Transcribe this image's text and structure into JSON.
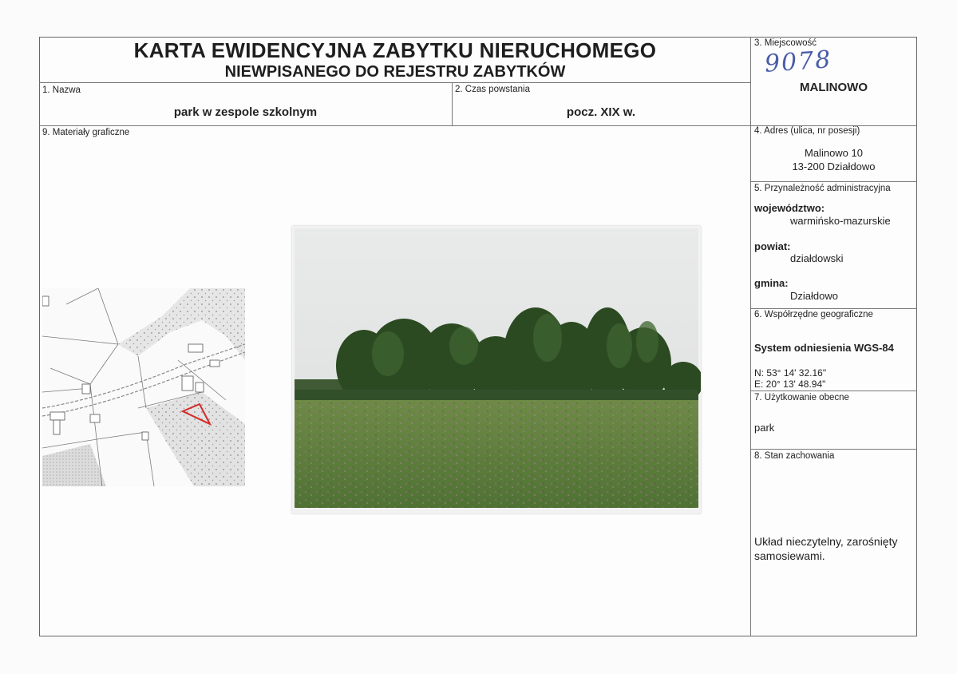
{
  "header": {
    "title_line1": "KARTA EWIDENCYJNA ZABYTKU NIERUCHOMEGO",
    "title_line2": "NIEWPISANEGO DO REJESTRU ZABYTKÓW"
  },
  "fields": {
    "nazwa_label": "1. Nazwa",
    "nazwa_value": "park w zespole szkolnym",
    "czas_label": "2. Czas powstania",
    "czas_value": "pocz. XIX w.",
    "miejscowosc_label": "3. Miejscowość",
    "miejscowosc_handwritten": "9078",
    "miejscowosc_value": "MALINOWO",
    "adres_label": "4. Adres (ulica, nr posesji)",
    "adres_line1": "Malinowo 10",
    "adres_line2": "13-200 Działdowo",
    "przynaleznosc_label": "5. Przynależność administracyjna",
    "wojewodztwo_label": "województwo:",
    "wojewodztwo_value": "warmińsko-mazurskie",
    "powiat_label": "powiat:",
    "powiat_value": "działdowski",
    "gmina_label": "gmina:",
    "gmina_value": "Działdowo",
    "wspolrzedne_label": "6. Współrzędne geograficzne",
    "system_value": "System odniesienia WGS-84",
    "coord_n": "N: 53° 14' 32.16\"",
    "coord_e": "E: 20° 13' 48.94\"",
    "uzytkowanie_label": "7. Użytkowanie obecne",
    "uzytkowanie_value": "park",
    "stan_label": "8. Stan zachowania",
    "stan_value_line1": "Układ nieczytelny, zarośnięty",
    "stan_value_line2": "samosiewami.",
    "materialy_label": "9. Materiały graficzne"
  },
  "colors": {
    "map_marker": "#d42a2a",
    "sky": "#e4e6e6",
    "trees": "#2c4a22",
    "meadow": "#5a7c3a"
  }
}
